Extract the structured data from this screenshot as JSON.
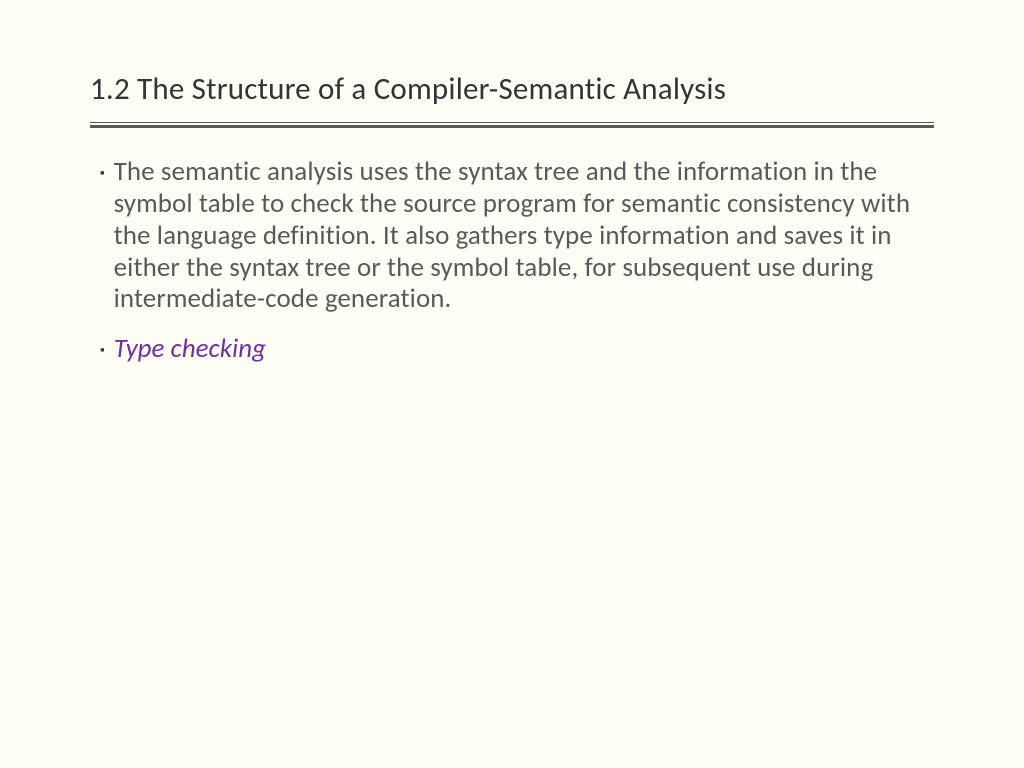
{
  "slide": {
    "title": "1.2 The Structure of a Compiler-Semantic Analysis",
    "bullets": [
      {
        "text": "The semantic analysis uses the syntax tree and the information in the symbol table to check the source program for semantic consistency with the language definition. It also gathers type information and saves it in either the syntax tree or the symbol table, for subsequent use during intermediate-code generation.",
        "highlight": false
      },
      {
        "text": "Type checking",
        "highlight": true
      }
    ]
  }
}
